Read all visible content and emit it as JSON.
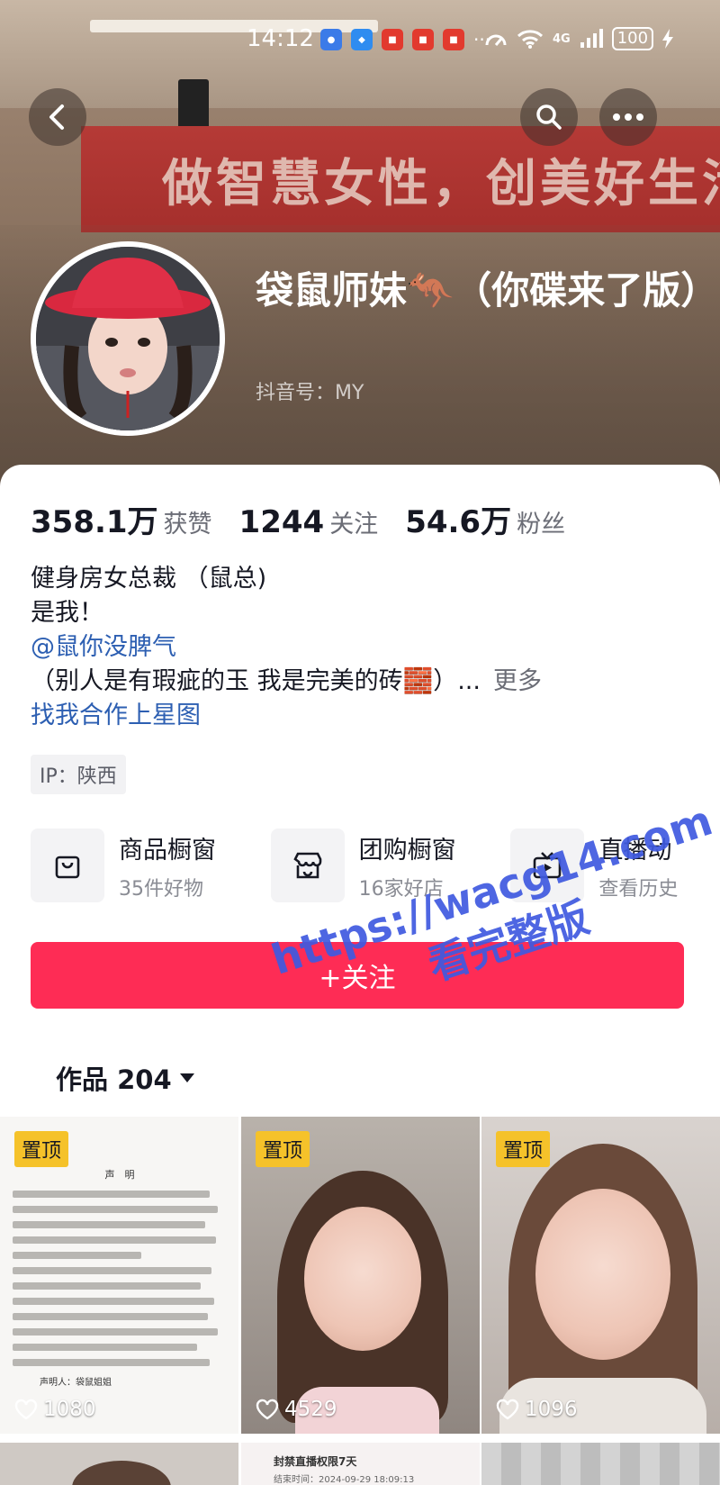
{
  "status_bar": {
    "time": "14:12",
    "more": "···",
    "network": "4G",
    "battery": "100"
  },
  "banner": {
    "slogan": "做智慧女性，创美好生活"
  },
  "profile": {
    "nickname": "袋鼠师妹🦘（你碟来了版）",
    "douyin_id": "抖音号：MY"
  },
  "stats": [
    {
      "value": "358.1万",
      "label": "获赞"
    },
    {
      "value": "1244",
      "label": "关注"
    },
    {
      "value": "54.6万",
      "label": "粉丝"
    }
  ],
  "bio": {
    "line1": "健身房女总裁 （鼠总)",
    "line2": "是我！",
    "mention": "@鼠你没脾气",
    "line4": "（别人是有瑕疵的玉 我是完美的砖🧱）...",
    "more": "更多",
    "link": "找我合作上星图"
  },
  "ip": "IP：陕西",
  "shortcuts": [
    {
      "title": "商品橱窗",
      "sub": "35件好物",
      "icon": "shopping-bag-icon"
    },
    {
      "title": "团购橱窗",
      "sub": "16家好店",
      "icon": "storefront-icon"
    },
    {
      "title": "直播动",
      "sub": "查看历史",
      "icon": "tv-icon"
    }
  ],
  "follow_button": "+关注",
  "works_tab": "作品 204",
  "watermark": {
    "line1": "https://wacg14.com",
    "line2": "看完整版"
  },
  "videos": [
    {
      "pinned": "置顶",
      "likes": "1080",
      "kind": "statement",
      "doc_title": "声　明",
      "doc_sign": "声明人：袋鼠姐姐"
    },
    {
      "pinned": "置顶",
      "likes": "4529",
      "kind": "selfie"
    },
    {
      "pinned": "置顶",
      "likes": "1096",
      "kind": "selfie"
    }
  ],
  "row2": {
    "notice_title": "封禁直播权限7天",
    "notice_time": "结束时间：2024-09-29 18:09:13"
  }
}
